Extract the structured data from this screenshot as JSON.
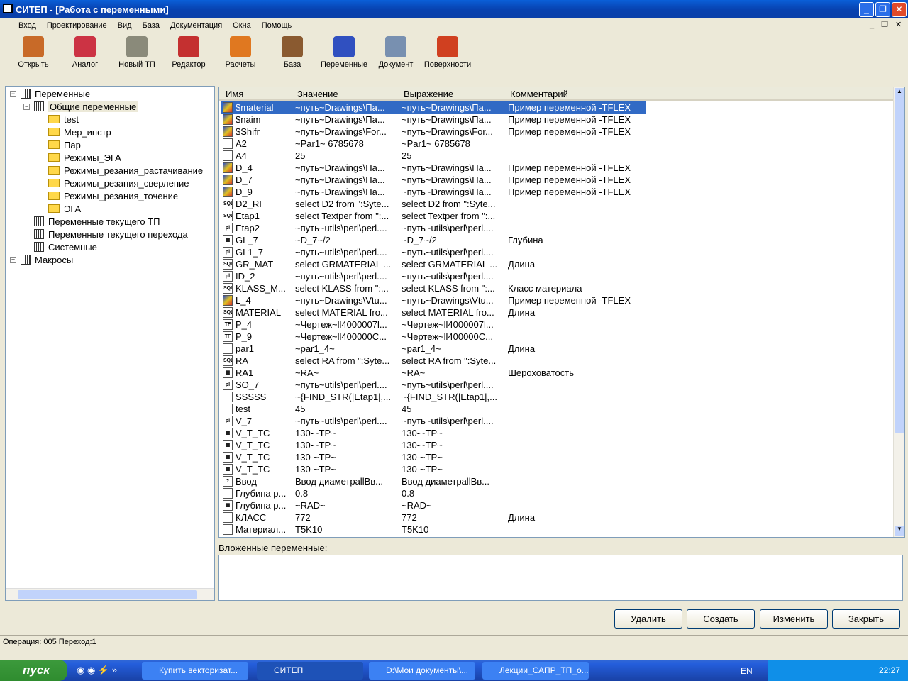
{
  "window": {
    "title": "СИТЕП - [Работа с переменными]"
  },
  "menu": [
    "Вход",
    "Проектирование",
    "Вид",
    "База",
    "Документация",
    "Окна",
    "Помощь"
  ],
  "toolbar": [
    {
      "label": "Открыть",
      "icon": "open-icon",
      "color": "#c86a28"
    },
    {
      "label": "Аналог",
      "icon": "analog-icon",
      "color": "#cc3344"
    },
    {
      "label": "Новый ТП",
      "icon": "new-tp-icon",
      "color": "#8a8a7a"
    },
    {
      "label": "Редактор",
      "icon": "editor-icon",
      "color": "#c43030"
    },
    {
      "label": "Расчеты",
      "icon": "calc-icon",
      "color": "#e07820"
    },
    {
      "label": "База",
      "icon": "database-icon",
      "color": "#8a5a30"
    },
    {
      "label": "Переменные",
      "icon": "fx-icon",
      "color": "#3050c0"
    },
    {
      "label": "Документ",
      "icon": "document-icon",
      "color": "#7890b0"
    },
    {
      "label": "Поверхности",
      "icon": "surfaces-icon",
      "color": "#d04020"
    }
  ],
  "tree": [
    {
      "label": "Переменные",
      "level": 0,
      "kind": "grid",
      "pm": "−"
    },
    {
      "label": "Общие переменные",
      "level": 1,
      "kind": "grid",
      "pm": "−",
      "selected": true
    },
    {
      "label": "test",
      "level": 2,
      "kind": "folder"
    },
    {
      "label": "Мер_инстр",
      "level": 2,
      "kind": "folder"
    },
    {
      "label": "Пар",
      "level": 2,
      "kind": "folder"
    },
    {
      "label": "Режимы_ЭГА",
      "level": 2,
      "kind": "folder"
    },
    {
      "label": "Режимы_резания_растачивание",
      "level": 2,
      "kind": "folder"
    },
    {
      "label": "Режимы_резания_сверление",
      "level": 2,
      "kind": "folder"
    },
    {
      "label": "Режимы_резания_точение",
      "level": 2,
      "kind": "folder"
    },
    {
      "label": "ЭГА",
      "level": 2,
      "kind": "folder"
    },
    {
      "label": "Переменные текущего ТП",
      "level": 1,
      "kind": "grid"
    },
    {
      "label": "Переменные текущего перехода",
      "level": 1,
      "kind": "grid"
    },
    {
      "label": "Системные",
      "level": 1,
      "kind": "grid"
    },
    {
      "label": "Макросы",
      "level": 0,
      "kind": "macro",
      "pm": "+"
    }
  ],
  "table": {
    "columns": [
      "Имя",
      "Значение",
      "Выражение",
      "Комментарий"
    ],
    "rows": [
      {
        "icon": "db",
        "name": "$material",
        "value": "~путь~Drawings\\Па...",
        "expr": "~путь~Drawings\\Па...",
        "comment": "Пример переменной -TFLEX"
      },
      {
        "icon": "db",
        "name": "$naim",
        "value": "~путь~Drawings\\Па...",
        "expr": "~путь~Drawings\\Па...",
        "comment": "Пример переменной -TFLEX"
      },
      {
        "icon": "db",
        "name": "$Shifr",
        "value": "~путь~Drawings\\For...",
        "expr": "~путь~Drawings\\For...",
        "comment": "Пример переменной -TFLEX"
      },
      {
        "icon": "file",
        "name": "A2",
        "value": "~Par1~ 6785678",
        "expr": "~Par1~ 6785678",
        "comment": ""
      },
      {
        "icon": "file",
        "name": "A4",
        "value": "25",
        "expr": "25",
        "comment": ""
      },
      {
        "icon": "db",
        "name": "D_4",
        "value": "~путь~Drawings\\Па...",
        "expr": "~путь~Drawings\\Па...",
        "comment": "Пример переменной -TFLEX"
      },
      {
        "icon": "db",
        "name": "D_7",
        "value": "~путь~Drawings\\Па...",
        "expr": "~путь~Drawings\\Па...",
        "comment": "Пример переменной -TFLEX"
      },
      {
        "icon": "db",
        "name": "D_9",
        "value": "~путь~Drawings\\Па...",
        "expr": "~путь~Drawings\\Па...",
        "comment": "Пример переменной -TFLEX"
      },
      {
        "icon": "sql",
        "name": "D2_RI",
        "value": "select  D2  from \":Syte...",
        "expr": "select  D2  from \":Syte...",
        "comment": ""
      },
      {
        "icon": "sql",
        "name": "Etap1",
        "value": "select Textper from \":...",
        "expr": "select Textper from \":...",
        "comment": ""
      },
      {
        "icon": "perl",
        "name": "Etap2",
        "value": "~путь~utils\\perl\\perl....",
        "expr": "~путь~utils\\perl\\perl....",
        "comment": ""
      },
      {
        "icon": "calc",
        "name": "GL_7",
        "value": "~D_7~/2",
        "expr": "~D_7~/2",
        "comment": "Глубина"
      },
      {
        "icon": "perl",
        "name": "GL1_7",
        "value": "~путь~utils\\perl\\perl....",
        "expr": "~путь~utils\\perl\\perl....",
        "comment": ""
      },
      {
        "icon": "sql",
        "name": "GR_MAT",
        "value": "select GRMATERIAL ...",
        "expr": "select GRMATERIAL ...",
        "comment": "Длина"
      },
      {
        "icon": "perl",
        "name": "ID_2",
        "value": "~путь~utils\\perl\\perl....",
        "expr": "~путь~utils\\perl\\perl....",
        "comment": ""
      },
      {
        "icon": "sql",
        "name": "KLASS_M...",
        "value": "select KLASS  from \":...",
        "expr": "select KLASS  from \":...",
        "comment": "Класс материала"
      },
      {
        "icon": "db",
        "name": "L_4",
        "value": "~путь~Drawings\\Vtu...",
        "expr": "~путь~Drawings\\Vtu...",
        "comment": "Пример переменной -TFLEX"
      },
      {
        "icon": "sql",
        "name": "MATERIAL",
        "value": "select MATERIAL fro...",
        "expr": "select MATERIAL fro...",
        "comment": "Длина"
      },
      {
        "icon": "tf",
        "name": "P_4",
        "value": "~Чертеж~ll4000007l...",
        "expr": "~Чертеж~ll4000007l...",
        "comment": ""
      },
      {
        "icon": "tf",
        "name": "P_9",
        "value": "~Чертеж~ll400000C...",
        "expr": "~Чертеж~ll400000C...",
        "comment": ""
      },
      {
        "icon": "file",
        "name": "par1",
        "value": "~par1_4~",
        "expr": "~par1_4~",
        "comment": "Длина"
      },
      {
        "icon": "sql",
        "name": "RA",
        "value": "select RA from \":Syte...",
        "expr": "select RA from \":Syte...",
        "comment": ""
      },
      {
        "icon": "calc",
        "name": "RA1",
        "value": "~RA~",
        "expr": "~RA~",
        "comment": "Шероховатость"
      },
      {
        "icon": "perl",
        "name": "SO_7",
        "value": "~путь~utils\\perl\\perl....",
        "expr": "~путь~utils\\perl\\perl....",
        "comment": ""
      },
      {
        "icon": "file",
        "name": "SSSSS",
        "value": "~{FIND_STR(|Etap1|,...",
        "expr": "~{FIND_STR(|Etap1|,...",
        "comment": ""
      },
      {
        "icon": "file",
        "name": "test",
        "value": "45",
        "expr": "45",
        "comment": ""
      },
      {
        "icon": "perl",
        "name": "V_7",
        "value": "~путь~utils\\perl\\perl....",
        "expr": "~путь~utils\\perl\\perl....",
        "comment": ""
      },
      {
        "icon": "calc",
        "name": "V_T_TC",
        "value": "130-~TP~",
        "expr": "130-~TP~",
        "comment": ""
      },
      {
        "icon": "calc",
        "name": "V_T_TC",
        "value": "130-~TP~",
        "expr": "130-~TP~",
        "comment": ""
      },
      {
        "icon": "calc",
        "name": "V_T_TC",
        "value": "130-~TP~",
        "expr": "130-~TP~",
        "comment": ""
      },
      {
        "icon": "calc",
        "name": "V_T_TC",
        "value": "130-~TP~",
        "expr": "130-~TP~",
        "comment": ""
      },
      {
        "icon": "query",
        "name": "Ввод",
        "value": "Ввод диаметраllВв...",
        "expr": "Ввод диаметраllВв...",
        "comment": ""
      },
      {
        "icon": "file",
        "name": "Глубина р...",
        "value": "0.8",
        "expr": "0.8",
        "comment": ""
      },
      {
        "icon": "calc",
        "name": "Глубина р...",
        "value": "~RAD~",
        "expr": "~RAD~",
        "comment": ""
      },
      {
        "icon": "file",
        "name": "КЛАСС",
        "value": "772",
        "expr": "772",
        "comment": "Длина"
      },
      {
        "icon": "file",
        "name": "Материал...",
        "value": "T5K10",
        "expr": "T5K10",
        "comment": ""
      }
    ]
  },
  "nested_label": "Вложенные переменные:",
  "nested_value": "",
  "buttons": {
    "delete": "Удалить",
    "create": "Создать",
    "edit": "Изменить",
    "close": "Закрыть"
  },
  "status": "Операция: 005 Переход:1",
  "taskbar": {
    "start": "пуск",
    "tasks": [
      "Купить векторизат...",
      "СИТЕП",
      "D:\\Мои документы\\...",
      "Лекции_САПР_ТП_о..."
    ],
    "lang": "EN",
    "clock": "22:27"
  },
  "colors": {
    "selection": "#316ac5",
    "titlebar": "#0842b0"
  }
}
